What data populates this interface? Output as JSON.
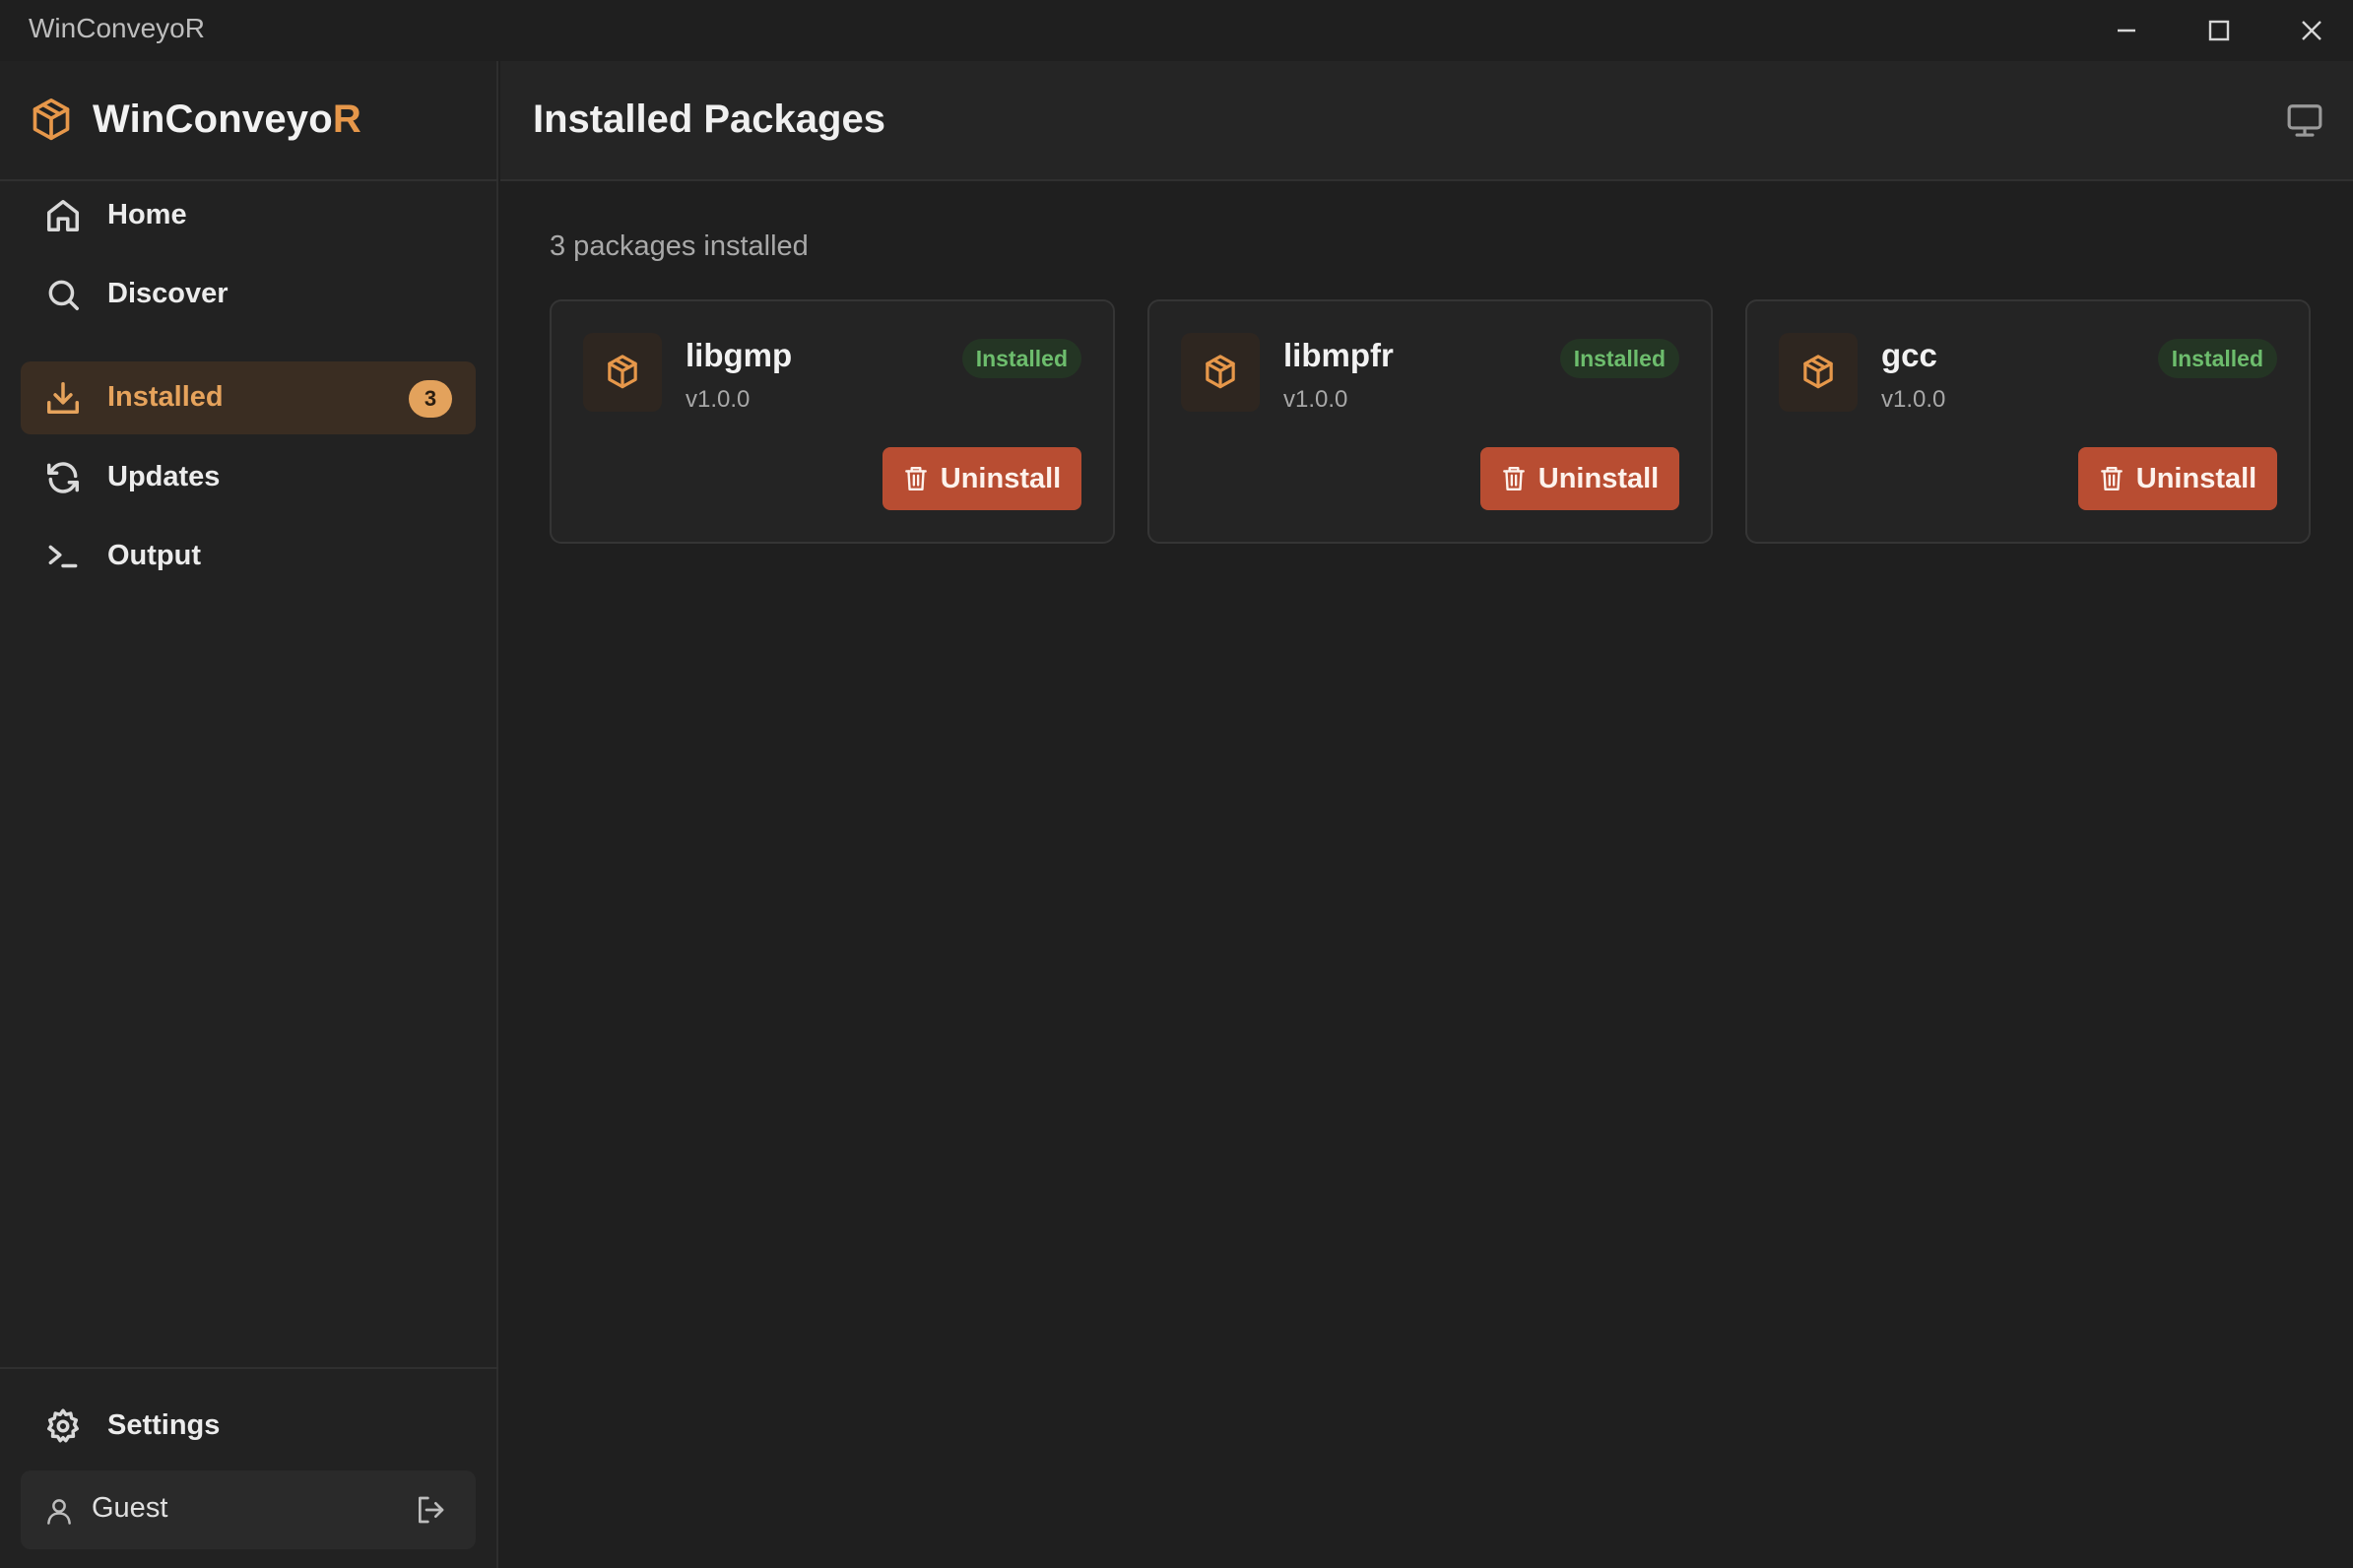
{
  "window": {
    "title": "WinConveyoR"
  },
  "brand": {
    "name_main": "WinConveyo",
    "name_accent": "R",
    "icon": "package-icon",
    "accent_color": "#e6974a"
  },
  "sidebar": {
    "items": [
      {
        "label": "Home",
        "icon": "home-icon"
      },
      {
        "label": "Discover",
        "icon": "search-icon"
      },
      {
        "label": "Installed",
        "icon": "download-icon",
        "active": true,
        "badge": "3"
      },
      {
        "label": "Updates",
        "icon": "refresh-icon"
      },
      {
        "label": "Output",
        "icon": "terminal-icon"
      }
    ],
    "settings_label": "Settings",
    "user": {
      "name": "Guest"
    }
  },
  "main": {
    "title": "Installed Packages",
    "count_text": "3 packages installed",
    "packages": [
      {
        "name": "libgmp",
        "version": "v1.0.0",
        "status": "Installed",
        "action": "Uninstall"
      },
      {
        "name": "libmpfr",
        "version": "v1.0.0",
        "status": "Installed",
        "action": "Uninstall"
      },
      {
        "name": "gcc",
        "version": "v1.0.0",
        "status": "Installed",
        "action": "Uninstall"
      }
    ]
  },
  "colors": {
    "background": "#1f1f1f",
    "active_nav_bg": "#3a2d22",
    "status_green": "#6dbd6d",
    "danger_button": "#b84d32"
  }
}
